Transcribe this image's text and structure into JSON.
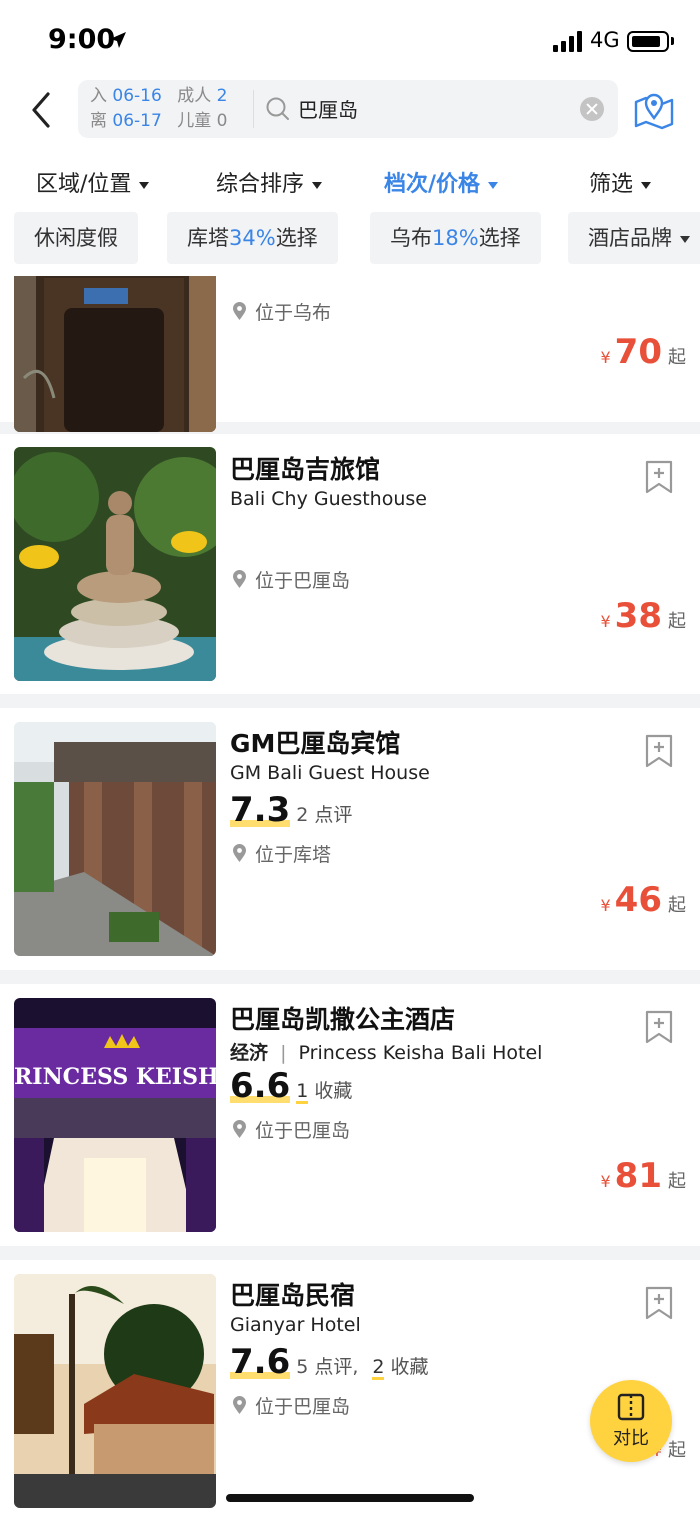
{
  "status_bar": {
    "time": "9:00",
    "network": "4G"
  },
  "search": {
    "checkin_label": "入",
    "checkin_date": "06-16",
    "checkout_label": "离",
    "checkout_date": "06-17",
    "adult_label": "成人",
    "adult_count": "2",
    "child_label": "儿童",
    "child_count": "0",
    "query": "巴厘岛"
  },
  "filters": [
    {
      "label": "区域/位置",
      "active": false
    },
    {
      "label": "综合排序",
      "active": false
    },
    {
      "label": "档次/价格",
      "active": true
    },
    {
      "label": "筛选",
      "active": false
    }
  ],
  "chips": [
    {
      "pre": "休闲度假",
      "hl": "",
      "post": ""
    },
    {
      "pre": "库塔",
      "hl": "34%",
      "post": "选择"
    },
    {
      "pre": "乌布",
      "hl": "18%",
      "post": "选择"
    },
    {
      "pre": "酒店品牌",
      "hl": "",
      "post": ""
    }
  ],
  "hotels": [
    {
      "name": "",
      "name_en": "",
      "score": "",
      "reviews": "",
      "location": "位于乌布",
      "currency": "¥",
      "price": "70",
      "price_suffix": "起"
    },
    {
      "name": "巴厘岛吉旅馆",
      "name_en": "Bali Chy Guesthouse",
      "location": "位于巴厘岛",
      "currency": "¥",
      "price": "38",
      "price_suffix": "起"
    },
    {
      "name": "GM巴厘岛宾馆",
      "name_en": "GM Bali Guest House",
      "score": "7.3",
      "reviews_count": "2",
      "reviews_label": "点评",
      "location": "位于库塔",
      "currency": "¥",
      "price": "46",
      "price_suffix": "起"
    },
    {
      "name": "巴厘岛凯撒公主酒店",
      "level": "经济",
      "sep": "|",
      "name_en": "Princess Keisha Bali Hotel",
      "score": "6.6",
      "fav_count": "1",
      "fav_label": "收藏",
      "sign_text": "RINCESS KEISHA",
      "location": "位于巴厘岛",
      "currency": "¥",
      "price": "81",
      "price_suffix": "起"
    },
    {
      "name": "巴厘岛民宿",
      "name_en": "Gianyar Hotel",
      "score": "7.6",
      "reviews_count": "5",
      "reviews_label": "点评,",
      "fav_count": "2",
      "fav_label": "收藏",
      "location": "位于巴厘岛",
      "currency": "¥",
      "price_suffix": "起"
    }
  ],
  "compare": {
    "label": "对比"
  },
  "colors": {
    "accent": "#3a85e6",
    "price": "#e8503a",
    "score_highlight": "#ffd23f"
  }
}
